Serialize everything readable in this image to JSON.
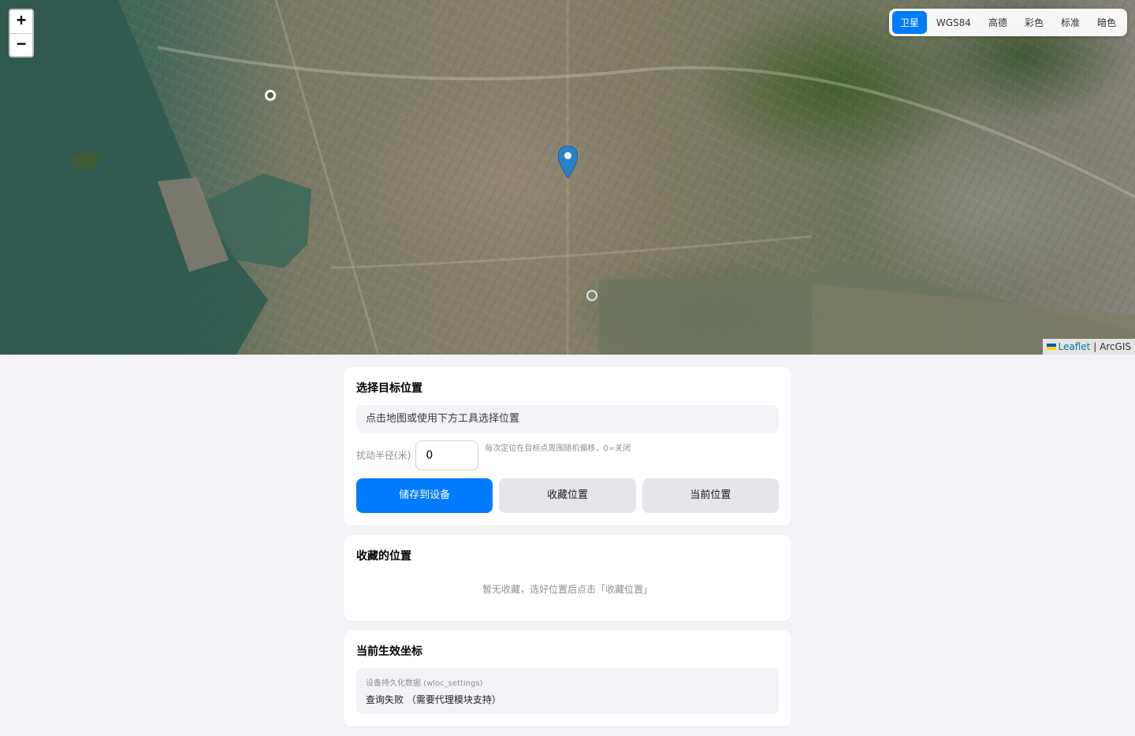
{
  "map": {
    "layers": [
      "卫星",
      "WGS84",
      "高德",
      "彩色",
      "标准",
      "暗色"
    ],
    "active_layer": "卫星",
    "zoom_in_label": "+",
    "zoom_out_label": "−",
    "attribution": {
      "leaflet": "Leaflet",
      "separator": " | ",
      "provider": "ArcGIS"
    }
  },
  "target": {
    "title": "选择目标位置",
    "location_text": "点击地图或使用下方工具选择位置",
    "jitter_label": "扰动半径(米)",
    "jitter_value": "0",
    "jitter_hint": "每次定位在目标点周围随机偏移，0=关闭",
    "buttons": {
      "save": "储存到设备",
      "favorite": "收藏位置",
      "current": "当前位置"
    }
  },
  "favorites": {
    "title": "收藏的位置",
    "empty_text": "暂无收藏，选好位置后点击「收藏位置」"
  },
  "active_coords": {
    "title": "当前生效坐标",
    "source_label": "设备持久化数据 (wloc_settings)",
    "value": "查询失败 （需要代理模块支持）"
  },
  "colors": {
    "accent": "#007aff",
    "marker": "#2a81cb",
    "background": "#f2f2f7"
  }
}
